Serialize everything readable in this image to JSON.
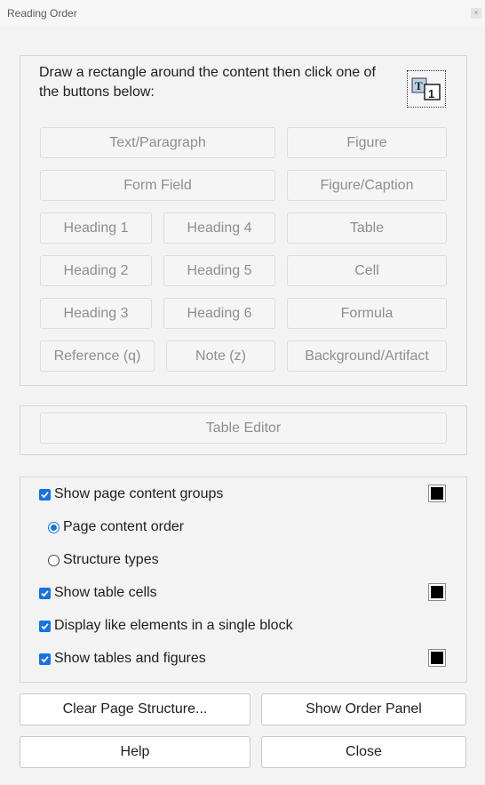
{
  "window": {
    "title": "Reading Order",
    "close_glyph": "×"
  },
  "tagging": {
    "instruction": "Draw a rectangle around the content then click one of the buttons below:",
    "icon": "touch-up-reading-order-tool-icon",
    "buttons": {
      "text_paragraph": "Text/Paragraph",
      "figure": "Figure",
      "form_field": "Form Field",
      "figure_caption": "Figure/Caption",
      "heading1": "Heading 1",
      "heading4": "Heading 4",
      "table": "Table",
      "heading2": "Heading 2",
      "heading5": "Heading 5",
      "cell": "Cell",
      "heading3": "Heading 3",
      "heading6": "Heading 6",
      "formula": "Formula",
      "reference": "Reference (q)",
      "note": "Note (z)",
      "background_artifact": "Background/Artifact"
    }
  },
  "table_editor": {
    "label": "Table Editor"
  },
  "display_options": {
    "show_page_content_groups": {
      "label": "Show page content groups",
      "checked": true,
      "color": "#000000"
    },
    "page_content_order": {
      "label": "Page content order",
      "selected": true
    },
    "structure_types": {
      "label": "Structure types",
      "selected": false
    },
    "show_table_cells": {
      "label": "Show table cells",
      "checked": true,
      "color": "#000000"
    },
    "display_like_elements": {
      "label": "Display like elements in a single block",
      "checked": true
    },
    "show_tables_figures": {
      "label": "Show tables and figures",
      "checked": true,
      "color": "#000000"
    }
  },
  "footer": {
    "clear_page_structure": "Clear Page Structure...",
    "show_order_panel": "Show Order Panel",
    "help": "Help",
    "close": "Close"
  },
  "colors": {
    "accent": "#1473e6",
    "background": "#f3f3f3"
  }
}
